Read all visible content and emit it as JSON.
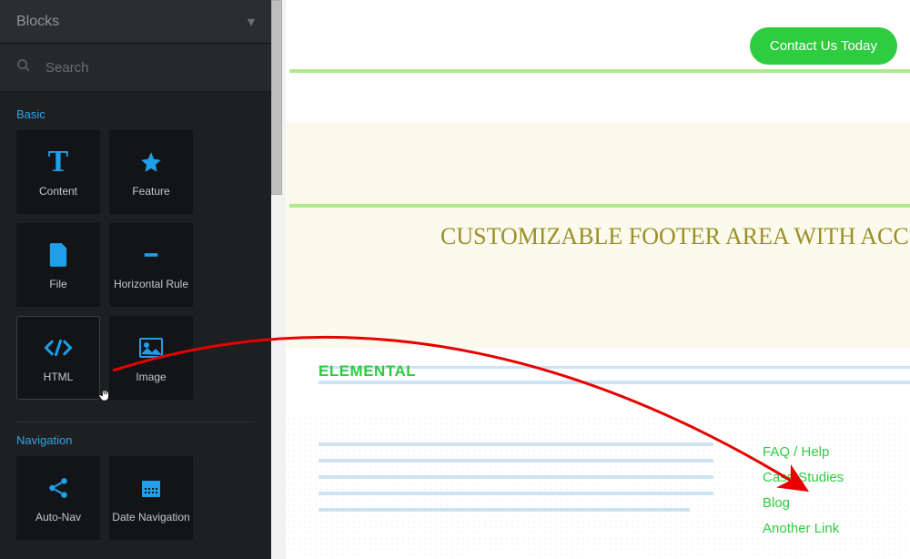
{
  "sidebar": {
    "title": "Blocks",
    "search_placeholder": "Search",
    "groups": [
      {
        "title": "Basic",
        "blocks": [
          {
            "id": "content",
            "label": "Content",
            "icon": "text"
          },
          {
            "id": "feature",
            "label": "Feature",
            "icon": "star"
          },
          {
            "id": "file",
            "label": "File",
            "icon": "file"
          },
          {
            "id": "hr",
            "label": "Horizontal Rule",
            "icon": "minus"
          },
          {
            "id": "html",
            "label": "HTML",
            "icon": "code",
            "selected": true
          },
          {
            "id": "image",
            "label": "Image",
            "icon": "image"
          }
        ]
      },
      {
        "title": "Navigation",
        "blocks": [
          {
            "id": "autonav",
            "label": "Auto-Nav",
            "icon": "share"
          },
          {
            "id": "datenav",
            "label": "Date Navigation",
            "icon": "calendar"
          }
        ]
      }
    ]
  },
  "canvas": {
    "contact_button": "Contact Us Today",
    "footer_heading": "CUSTOMIZABLE FOOTER AREA WITH ACC",
    "brand": "ELEMENTAL",
    "links": [
      "FAQ / Help",
      "Case Studies",
      "Blog",
      "Another Link"
    ]
  },
  "colors": {
    "accent_green": "#2ecc40",
    "accent_blue": "#1f9fe8",
    "arrow": "#e80000"
  }
}
